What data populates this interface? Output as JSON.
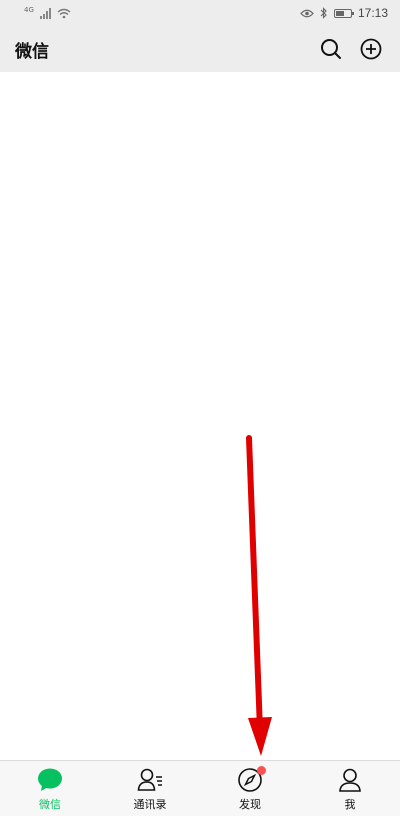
{
  "status_bar": {
    "network_label": "4G",
    "time": "17:13"
  },
  "header": {
    "title": "微信",
    "icons": [
      "search-icon",
      "add-icon"
    ]
  },
  "tabs": [
    {
      "label": "微信",
      "icon": "chat-bubble-icon",
      "active": true
    },
    {
      "label": "通讯录",
      "icon": "contacts-icon",
      "active": false
    },
    {
      "label": "发现",
      "icon": "compass-icon",
      "active": false,
      "badge_dot": true
    },
    {
      "label": "我",
      "icon": "person-icon",
      "active": false
    }
  ],
  "colors": {
    "accent": "#07c160",
    "badge": "#fa5151",
    "header_bg": "#ededed",
    "annotation_arrow": "#e00000"
  }
}
